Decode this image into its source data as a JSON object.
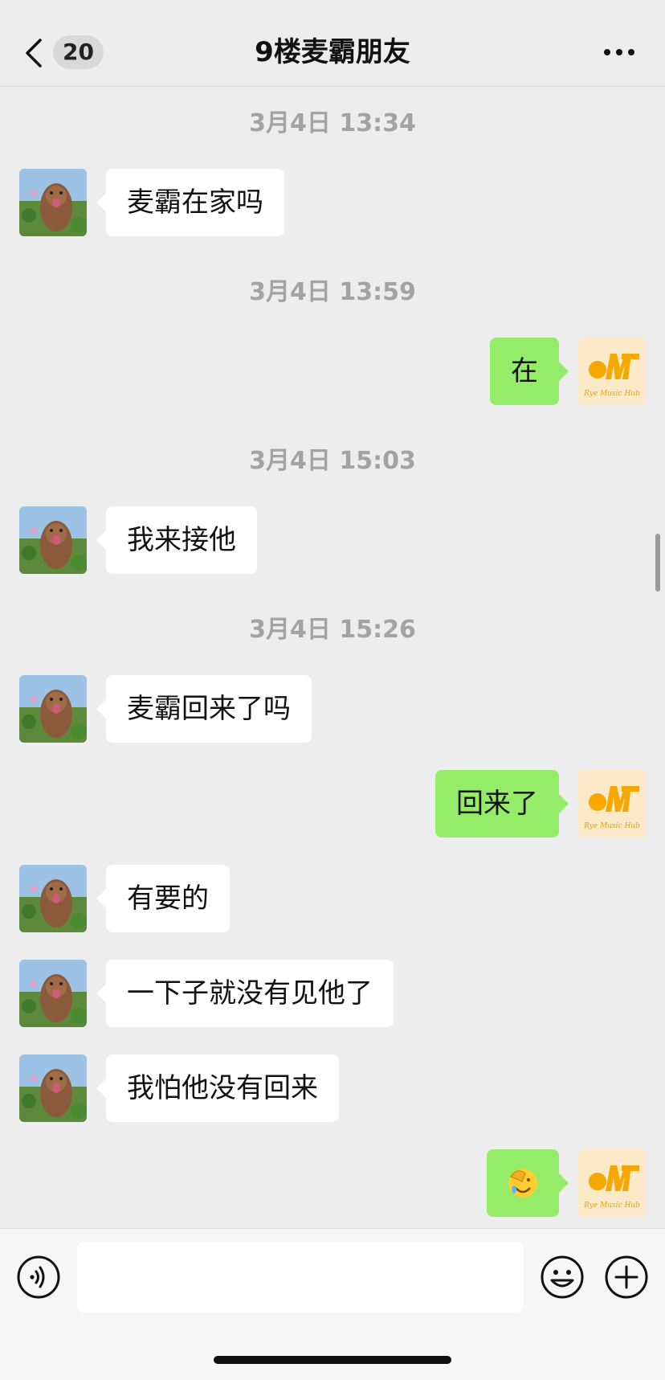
{
  "header": {
    "unread_count": "20",
    "title": "9楼麦霸朋友"
  },
  "messages": [
    {
      "type": "time",
      "text": "3月4日 13:34"
    },
    {
      "type": "msg",
      "side": "left",
      "text": "麦霸在家吗"
    },
    {
      "type": "time",
      "text": "3月4日 13:59"
    },
    {
      "type": "msg",
      "side": "right",
      "text": "在"
    },
    {
      "type": "time",
      "text": "3月4日 15:03"
    },
    {
      "type": "msg",
      "side": "left",
      "text": "我来接他"
    },
    {
      "type": "time",
      "text": "3月4日 15:26"
    },
    {
      "type": "msg",
      "side": "left",
      "text": "麦霸回来了吗"
    },
    {
      "type": "msg",
      "side": "right",
      "text": "回来了"
    },
    {
      "type": "msg",
      "side": "left",
      "text": "有要的"
    },
    {
      "type": "msg",
      "side": "left",
      "text": "一下子就没有见他了"
    },
    {
      "type": "msg",
      "side": "left",
      "text": "我怕他没有回来"
    },
    {
      "type": "msg",
      "side": "right",
      "text": "🤦",
      "icon": "facepalm-emoji"
    }
  ],
  "self_avatar": {
    "logo_text": "Rye Music Hub",
    "colors": {
      "background": "#fbe9c8",
      "logo": "#f5a800"
    }
  },
  "input": {
    "value": "",
    "placeholder": ""
  },
  "icons": {
    "back": "chevron-left-icon",
    "more": "more-dots-icon",
    "voice": "voice-icon",
    "emoji": "emoji-icon",
    "plus": "plus-icon"
  },
  "colors": {
    "background": "#ededed",
    "bubble_self": "#95ec69",
    "bubble_other": "#ffffff",
    "timestamp": "#a3a3a3"
  }
}
